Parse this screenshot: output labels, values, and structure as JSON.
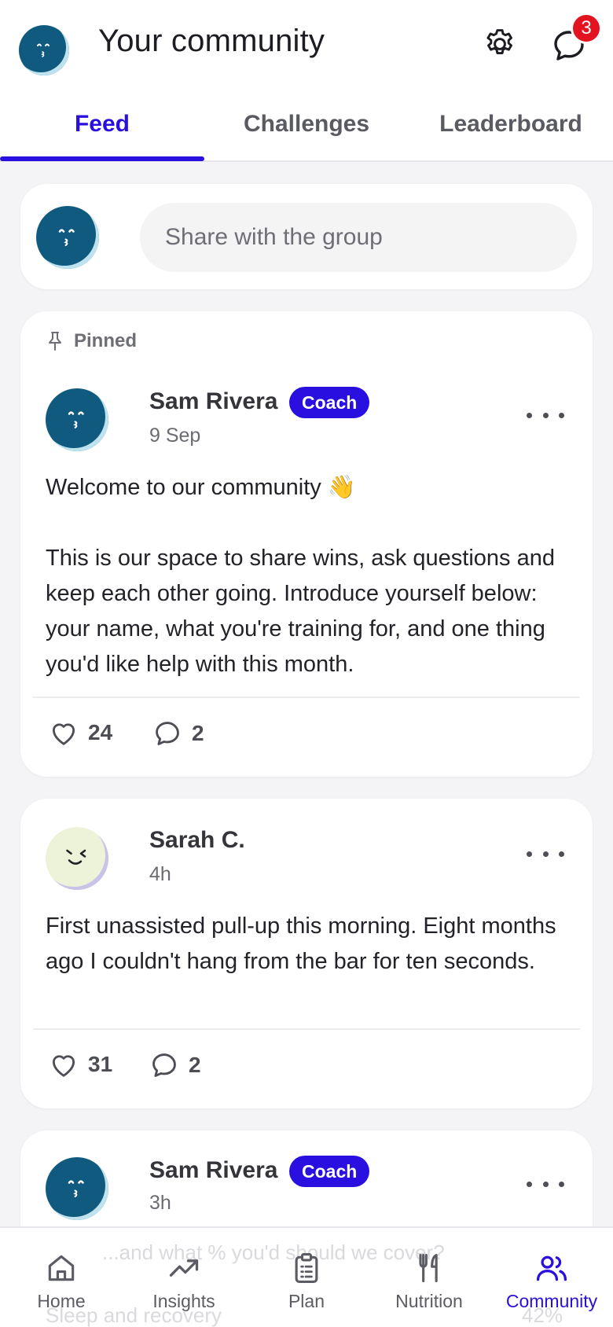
{
  "header": {
    "title": "Your community",
    "unread_count": "3"
  },
  "tabs": [
    {
      "label": "Feed",
      "active": true
    },
    {
      "label": "Challenges",
      "active": false
    },
    {
      "label": "Leaderboard",
      "active": false
    }
  ],
  "composer": {
    "placeholder": "Share with the group"
  },
  "posts": [
    {
      "pinned_label": "Pinned",
      "author": "Sam Rivera",
      "role_badge": "Coach",
      "time": "9 Sep",
      "body": "Welcome to our community 👋\n\nThis is our space to share wins, ask questions and keep each other going. Introduce yourself below: your name, what you're training for, and one thing you'd like help with this month.",
      "likes": "24",
      "comments": "2"
    },
    {
      "author": "Sarah C.",
      "time": "4h",
      "body": "First unassisted pull-up this morning. Eight months ago I couldn't hang from the bar for ten seconds.",
      "likes": "31",
      "comments": "2"
    },
    {
      "author": "Sam Rivera",
      "role_badge": "Coach",
      "time": "3h"
    }
  ],
  "behind_nav_text": {
    "line1": "...and what % you'd should we cover?",
    "line2": "Sleep and recovery",
    "line2_value": "42%"
  },
  "bottom_nav": [
    {
      "label": "Home",
      "icon": "home-icon",
      "active": false
    },
    {
      "label": "Insights",
      "icon": "trend-icon",
      "active": false
    },
    {
      "label": "Plan",
      "icon": "clipboard-icon",
      "active": false
    },
    {
      "label": "Nutrition",
      "icon": "fork-knife-icon",
      "active": false
    },
    {
      "label": "Community",
      "icon": "people-icon",
      "active": true
    }
  ],
  "colors": {
    "accent": "#2a10e0",
    "badge_red": "#e3141f",
    "avatar_blue": "#0f5a7e"
  }
}
